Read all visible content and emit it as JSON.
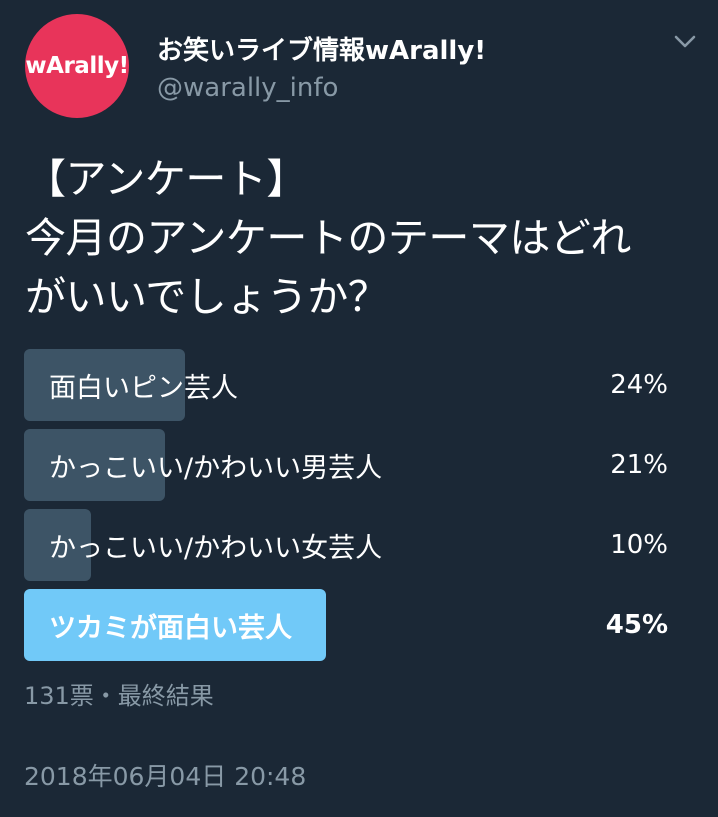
{
  "account": {
    "avatar_text": "wArally!",
    "avatar_color": "#e8345a",
    "display_name": "お笑いライブ情報wArally!",
    "handle": "@warally_info"
  },
  "tweet": {
    "text": "【アンケート】\n今月のアンケートのテーマはどれ\nがいいでしょうか？"
  },
  "poll": {
    "options": [
      {
        "label": "面白いピン芸人",
        "percent_text": "24%",
        "percent": 24,
        "winner": false
      },
      {
        "label": "かっこいい/かわいい男芸人",
        "percent_text": "21%",
        "percent": 21,
        "winner": false
      },
      {
        "label": "かっこいい/かわいい女芸人",
        "percent_text": "10%",
        "percent": 10,
        "winner": false
      },
      {
        "label": "ツカミが面白い芸人",
        "percent_text": "45%",
        "percent": 45,
        "winner": true
      }
    ],
    "meta": "131票・最終結果",
    "bar_color": "#3d5466",
    "winner_color": "#71c9f8"
  },
  "timestamp": "2018年06月04日 20:48",
  "icons": {
    "menu": "chevron-down-icon"
  },
  "colors": {
    "background": "#1b2836",
    "secondary_text": "#8899a6"
  }
}
